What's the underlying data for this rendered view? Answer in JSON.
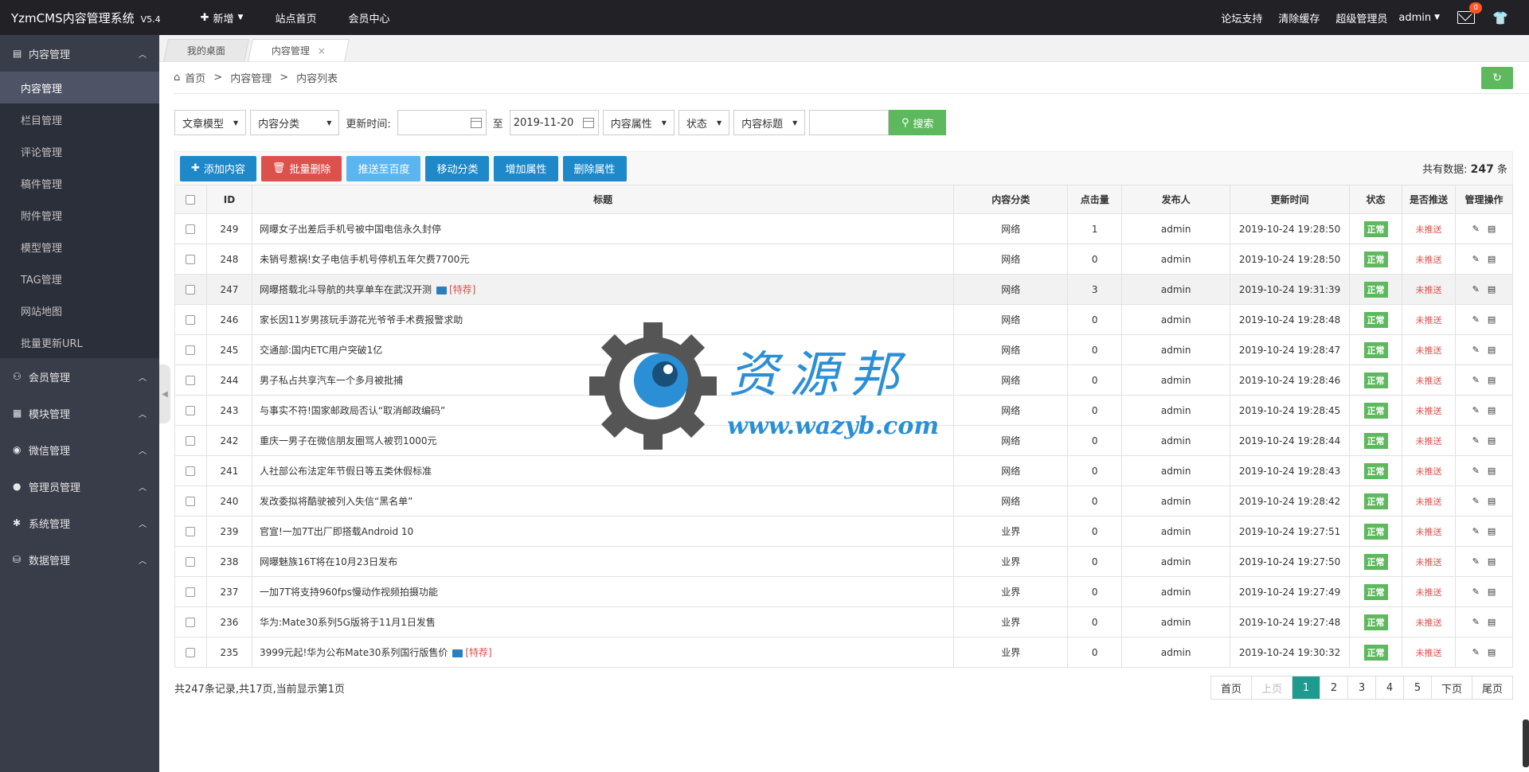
{
  "topbar": {
    "brand": "YzmCMS内容管理系统",
    "version": "V5.4",
    "nav": [
      {
        "label": "新增",
        "icon": "plus-icon",
        "caret": true
      },
      {
        "label": "站点首页"
      },
      {
        "label": "会员中心"
      }
    ],
    "right": [
      "论坛支持",
      "清除缓存",
      "超级管理员"
    ],
    "user": "admin",
    "mail_badge": "0"
  },
  "sidebar": {
    "groups": [
      {
        "label": "内容管理",
        "icon": "list-icon",
        "expanded": true,
        "items": [
          "内容管理",
          "栏目管理",
          "评论管理",
          "稿件管理",
          "附件管理",
          "模型管理",
          "TAG管理",
          "网站地图",
          "批量更新URL"
        ]
      },
      {
        "label": "会员管理",
        "icon": "user-icon"
      },
      {
        "label": "模块管理",
        "icon": "grid-icon"
      },
      {
        "label": "微信管理",
        "icon": "wechat-icon"
      },
      {
        "label": "管理员管理",
        "icon": "admin-icon"
      },
      {
        "label": "系统管理",
        "icon": "gear-icon"
      },
      {
        "label": "数据管理",
        "icon": "database-icon"
      }
    ],
    "active_item": "内容管理"
  },
  "tabs": [
    {
      "label": "我的桌面",
      "active": false
    },
    {
      "label": "内容管理",
      "active": true,
      "closable": true
    }
  ],
  "breadcrumb": {
    "items": [
      "首页",
      "内容管理",
      "内容列表"
    ],
    "separator": ">"
  },
  "filters": {
    "model": "文章模型",
    "category": "内容分类",
    "time_label": "更新时间:",
    "date_from": "",
    "to_label": "至",
    "date_to": "2019-11-20",
    "attribute": "内容属性",
    "status": "状态",
    "field": "内容标题",
    "keyword": "",
    "search_label": "搜索"
  },
  "actions": {
    "add": "添加内容",
    "batch_delete": "批量删除",
    "push_baidu": "推送至百度",
    "move": "移动分类",
    "add_attr": "增加属性",
    "del_attr": "删除属性",
    "total_label": "共有数据:",
    "total_value": "247",
    "total_unit": "条"
  },
  "table": {
    "headers": [
      "ID",
      "标题",
      "内容分类",
      "点击量",
      "发布人",
      "更新时间",
      "状态",
      "是否推送",
      "管理操作"
    ],
    "rows": [
      {
        "id": "249",
        "title": "网曝女子出差后手机号被中国电信永久封停",
        "cat": "网络",
        "hits": "1",
        "user": "admin",
        "time": "2019-10-24 19:28:50",
        "status": "正常",
        "push": "未推送"
      },
      {
        "id": "248",
        "title": "未销号惹祸!女子电信手机号停机五年欠费7700元",
        "cat": "网络",
        "hits": "0",
        "user": "admin",
        "time": "2019-10-24 19:28:50",
        "status": "正常",
        "push": "未推送"
      },
      {
        "id": "247",
        "title": "网曝搭载北斗导航的共享单车在武汉开测",
        "img": true,
        "flag": "[特荐]",
        "cat": "网络",
        "hits": "3",
        "user": "admin",
        "time": "2019-10-24 19:31:39",
        "status": "正常",
        "push": "未推送",
        "highlight": true
      },
      {
        "id": "246",
        "title": "家长因11岁男孩玩手游花光爷爷手术费报警求助",
        "cat": "网络",
        "hits": "0",
        "user": "admin",
        "time": "2019-10-24 19:28:48",
        "status": "正常",
        "push": "未推送"
      },
      {
        "id": "245",
        "title": "交通部:国内ETC用户突破1亿",
        "cat": "网络",
        "hits": "0",
        "user": "admin",
        "time": "2019-10-24 19:28:47",
        "status": "正常",
        "push": "未推送"
      },
      {
        "id": "244",
        "title": "男子私占共享汽车一个多月被批捕",
        "cat": "网络",
        "hits": "0",
        "user": "admin",
        "time": "2019-10-24 19:28:46",
        "status": "正常",
        "push": "未推送"
      },
      {
        "id": "243",
        "title": "与事实不符!国家邮政局否认“取消邮政编码”",
        "cat": "网络",
        "hits": "0",
        "user": "admin",
        "time": "2019-10-24 19:28:45",
        "status": "正常",
        "push": "未推送"
      },
      {
        "id": "242",
        "title": "重庆一男子在微信朋友圈骂人被罚1000元",
        "cat": "网络",
        "hits": "0",
        "user": "admin",
        "time": "2019-10-24 19:28:44",
        "status": "正常",
        "push": "未推送"
      },
      {
        "id": "241",
        "title": "人社部公布法定年节假日等五类休假标准",
        "cat": "网络",
        "hits": "0",
        "user": "admin",
        "time": "2019-10-24 19:28:43",
        "status": "正常",
        "push": "未推送"
      },
      {
        "id": "240",
        "title": "发改委拟将酷驶被列入失信“黑名单”",
        "cat": "网络",
        "hits": "0",
        "user": "admin",
        "time": "2019-10-24 19:28:42",
        "status": "正常",
        "push": "未推送"
      },
      {
        "id": "239",
        "title": "官宣!一加7T出厂即搭载Android 10",
        "cat": "业界",
        "hits": "0",
        "user": "admin",
        "time": "2019-10-24 19:27:51",
        "status": "正常",
        "push": "未推送"
      },
      {
        "id": "238",
        "title": "网曝魅族16T将在10月23日发布",
        "cat": "业界",
        "hits": "0",
        "user": "admin",
        "time": "2019-10-24 19:27:50",
        "status": "正常",
        "push": "未推送"
      },
      {
        "id": "237",
        "title": "一加7T将支持960fps慢动作视频拍摄功能",
        "cat": "业界",
        "hits": "0",
        "user": "admin",
        "time": "2019-10-24 19:27:49",
        "status": "正常",
        "push": "未推送"
      },
      {
        "id": "236",
        "title": "华为:Mate30系列5G版将于11月1日发售",
        "cat": "业界",
        "hits": "0",
        "user": "admin",
        "time": "2019-10-24 19:27:48",
        "status": "正常",
        "push": "未推送"
      },
      {
        "id": "235",
        "title": "3999元起!华为公布Mate30系列国行版售价",
        "img": true,
        "flag": "[特荐]",
        "cat": "业界",
        "hits": "0",
        "user": "admin",
        "time": "2019-10-24 19:30:32",
        "status": "正常",
        "push": "未推送"
      }
    ]
  },
  "summary": "共247条记录,共17页,当前显示第1页",
  "pagination": {
    "first": "首页",
    "prev": "上页",
    "pages": [
      "1",
      "2",
      "3",
      "4",
      "5"
    ],
    "current": "1",
    "next": "下页",
    "last": "尾页"
  },
  "watermark": {
    "title": "资源邦",
    "url": "www.wazyb.com"
  },
  "colors": {
    "sidebar": "#393d49",
    "topbar": "#222226",
    "primary_blue": "#1e88c8",
    "green": "#5eb95e",
    "red": "#dd514c",
    "page_active": "#1e9a8f"
  }
}
